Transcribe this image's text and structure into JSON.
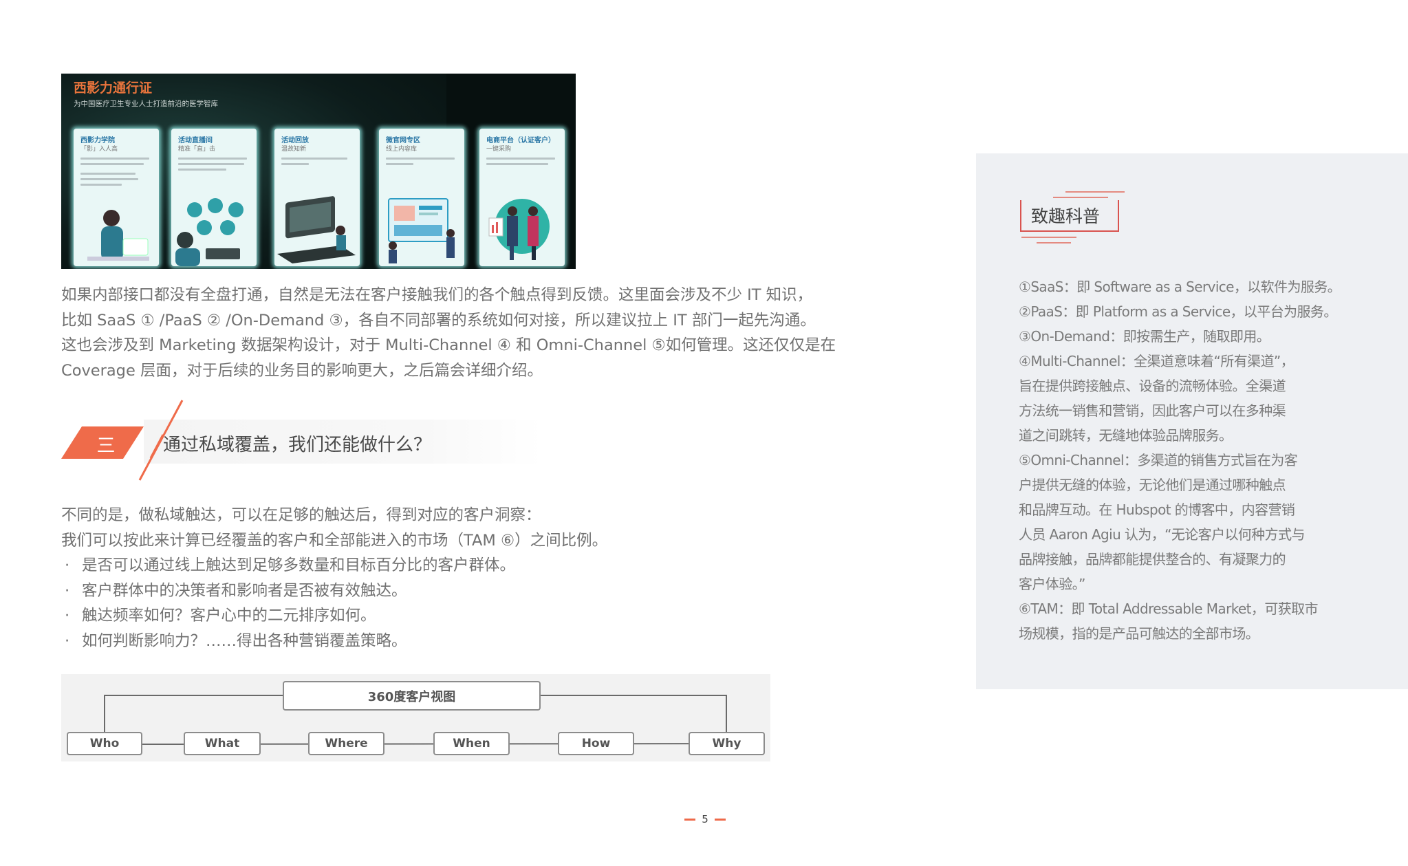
{
  "banner": {
    "title": "西影力通行证",
    "subtitle": "为中国医疗卫生专业人士打造前沿的医学智库",
    "cards": [
      {
        "title": "西影力学院",
        "subtitle": "「影」入人高"
      },
      {
        "title": "活动直播间",
        "subtitle": "精准「直」击"
      },
      {
        "title": "活动回放",
        "subtitle": "温故知新"
      },
      {
        "title": "微官网专区",
        "subtitle": "线上内容库"
      },
      {
        "title": "电商平台（认证客户）",
        "subtitle": "一键采购"
      }
    ]
  },
  "paragraph": {
    "lines": [
      "如果内部接口都没有全盘打通，自然是无法在客户接触我们的各个触点得到反馈。这里面会涉及不少 IT 知识，",
      "比如 SaaS ① /PaaS ② /On-Demand ③，各自不同部署的系统如何对接，所以建议拉上 IT 部门一起先沟通。",
      "这也会涉及到 Marketing 数据架构设计，对于 Multi-Channel ④ 和 Omni-Channel ⑤如何管理。这还仅仅是在",
      "Coverage 层面，对于后续的业务目的影响更大，之后篇会详细介绍。"
    ]
  },
  "section": {
    "number": "三",
    "title": "通过私域覆盖，我们还能做什么？"
  },
  "list": {
    "intro": [
      "不同的是，做私域触达，可以在足够的触达后，得到对应的客户洞察：",
      "我们可以按此来计算已经覆盖的客户和全部能进入的市场（TAM ⑥）之间比例。"
    ],
    "bullet": "·",
    "items": [
      "是否可以通过线上触达到足够多数量和目标百分比的客户群体。",
      "客户群体中的决策者和影响者是否被有效触达。",
      "触达频率如何？客户心中的二元排序如何。",
      "如何判断影响力？……得出各种营销覆盖策略。"
    ]
  },
  "diagram": {
    "root": "360度客户视图",
    "nodes": [
      "Who",
      "What",
      "Where",
      "When",
      "How",
      "Why"
    ]
  },
  "page_number": "5",
  "sidebar": {
    "title": "致趣科普",
    "notes": [
      "①SaaS：即 Software as a Service，以软件为服务。",
      "②PaaS：即 Platform as a Service，以平台为服务。",
      "③On-Demand：即按需生产，随取即用。",
      "④Multi-Channel：全渠道意味着“所有渠道”，",
      "旨在提供跨接触点、设备的流畅体验。全渠道",
      "方法统一销售和营销，因此客户可以在多种渠",
      "道之间跳转，无缝地体验品牌服务。",
      "⑤Omni-Channel：多渠道的销售方式旨在为客",
      "户提供无缝的体验，无论他们是通过哪种触点",
      "和品牌互动。在 Hubspot 的博客中，内容营销",
      "人员 Aaron Agiu 认为，“无论客户以何种方式与",
      "品牌接触，品牌都能提供整合的、有凝聚力的",
      "客户体验。”",
      "⑥TAM：即 Total Addressable Market，可获取市",
      "场规模，指的是产品可触达的全部市场。"
    ]
  },
  "colors": {
    "accent_orange": "#ef6b4a",
    "accent_red": "#d9534f",
    "sidebar_bg": "#eef0f3",
    "text_gray": "#717171"
  }
}
